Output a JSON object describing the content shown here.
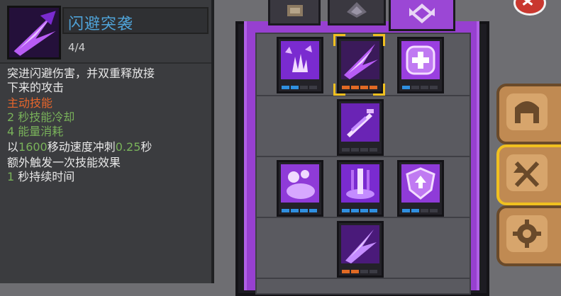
{
  "skill": {
    "name": "闪避突袭",
    "level": "4/4",
    "description": [
      "突进闪避伤害，并双重释放接",
      "下来的攻击"
    ],
    "type_label": "主动技能",
    "cooldown": {
      "value": "2",
      "label": "秒技能冷却"
    },
    "energy": {
      "value": "4",
      "label": "能量消耗"
    },
    "effect": {
      "prefix": "以",
      "speed": "1600",
      "middle": "移动速度冲刺",
      "time": "0.25",
      "suffix": "秒"
    },
    "extra": "额外触发一次技能效果",
    "duration": {
      "value": "1",
      "label": "秒持续时间"
    }
  },
  "tree": {
    "tabs": [
      "card-tab-icon",
      "crest-tab-icon",
      "assassin-tab-icon"
    ],
    "active_tab": 2,
    "nodes": [
      {
        "id": "burst-skill",
        "icon": "burst-icon",
        "pips": [
          "blue",
          "blue",
          "empty",
          "empty",
          "empty"
        ]
      },
      {
        "id": "dash-strike",
        "icon": "dash-strike-icon",
        "pips": [
          "orange",
          "orange",
          "orange",
          "orange",
          "empty"
        ],
        "selected": true
      },
      {
        "id": "heal-skill",
        "icon": "plus-icon",
        "pips": [
          "blue",
          "empty",
          "empty",
          "empty",
          "empty"
        ]
      },
      {
        "id": "blade-skill",
        "icon": "blades-icon",
        "pips": [
          "empty",
          "empty",
          "empty",
          "empty",
          "empty"
        ]
      },
      {
        "id": "pet-skill",
        "icon": "pet-icon",
        "pips": [
          "blue",
          "blue",
          "blue",
          "blue",
          "empty"
        ]
      },
      {
        "id": "sword-aura",
        "icon": "sword-aura-icon",
        "pips": [
          "blue",
          "blue",
          "blue",
          "blue",
          "empty"
        ]
      },
      {
        "id": "shield-skill",
        "icon": "shield-icon",
        "pips": [
          "blue",
          "blue",
          "empty",
          "empty",
          "empty"
        ]
      },
      {
        "id": "lightning-dash",
        "icon": "lightning-dash-icon",
        "pips": [
          "orange",
          "orange",
          "empty",
          "empty",
          "empty"
        ]
      }
    ]
  },
  "side_buttons": [
    "helmet-icon",
    "swords-up-icon",
    "gear-icon"
  ],
  "colors": {
    "accent": "#9b47d5",
    "orange": "#e8662b",
    "green": "#79b25a",
    "name_blue": "#4fa3d8"
  }
}
